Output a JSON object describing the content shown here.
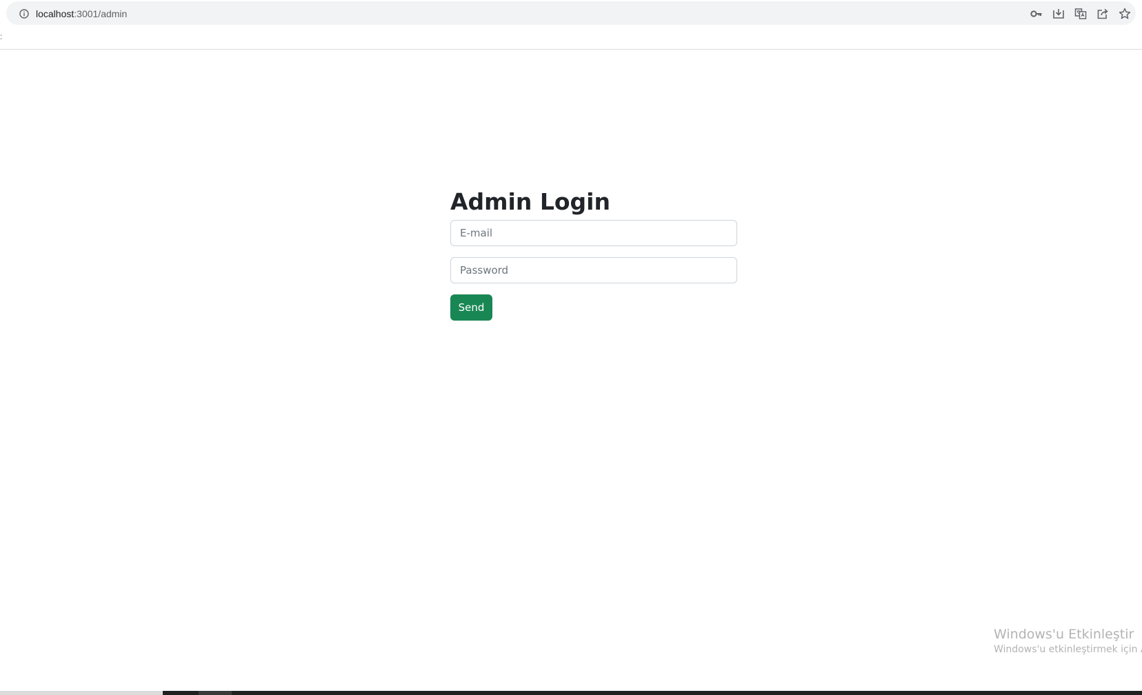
{
  "browser": {
    "url_host": "localhost",
    "url_rest": ":3001/admin",
    "bookmark_stub": ":",
    "toolbar_icons": [
      "key-icon",
      "install-icon",
      "translate-icon",
      "share-icon",
      "star-icon"
    ]
  },
  "login": {
    "title": "Admin Login",
    "email_placeholder": "E-mail",
    "password_placeholder": "Password",
    "send_label": "Send"
  },
  "colors": {
    "button_bg": "#198754",
    "text": "#212529",
    "input_border": "#ced4da"
  },
  "watermark": {
    "title": "Windows'u Etkinleştir",
    "subtitle": "Windows'u etkinleştirmek için Ay"
  }
}
